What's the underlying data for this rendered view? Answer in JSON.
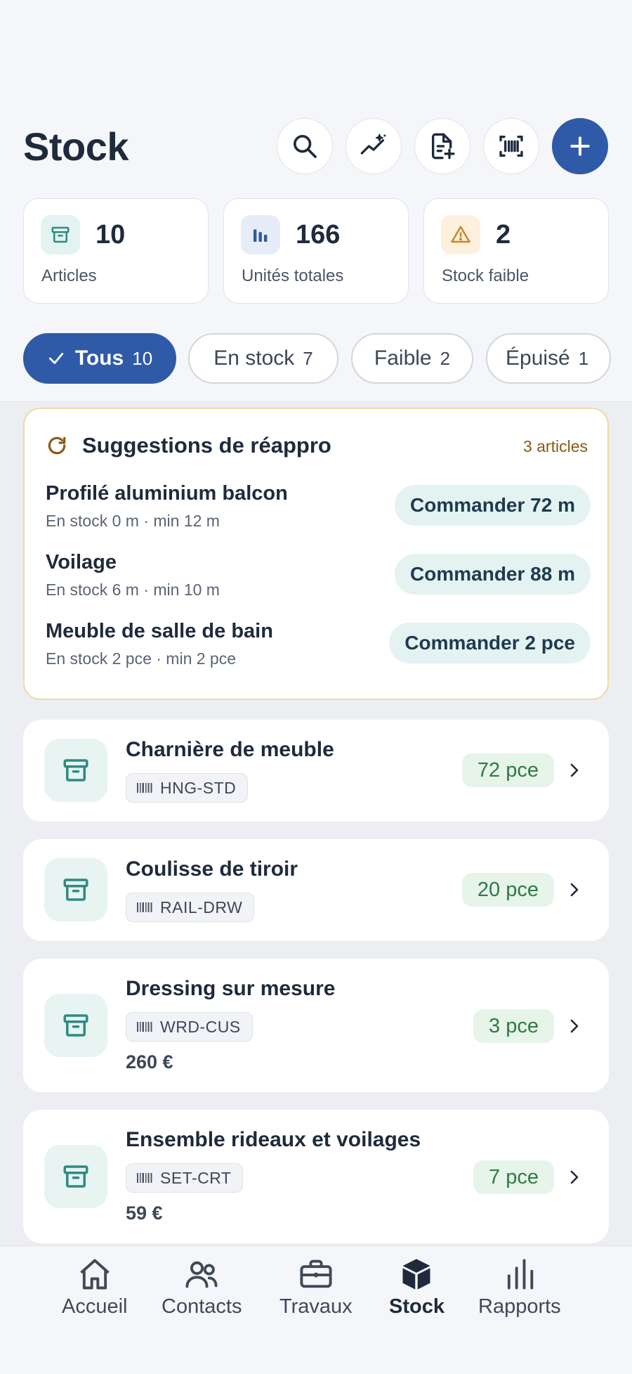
{
  "header": {
    "title": "Stock"
  },
  "actions": [
    {
      "name": "search-button",
      "icon": "search-icon"
    },
    {
      "name": "trend-button",
      "icon": "sparkle-trend-icon"
    },
    {
      "name": "add-document-button",
      "icon": "document-plus-icon"
    },
    {
      "name": "barcode-scan-button",
      "icon": "barcode-scan-icon"
    },
    {
      "name": "add-item-button",
      "icon": "plus-icon"
    }
  ],
  "stats": [
    {
      "value": "10",
      "label": "Articles",
      "icon": "archive-icon",
      "color": "#e3f3f1"
    },
    {
      "value": "166",
      "label": "Unités totales",
      "icon": "bars-icon",
      "color": "#e6ecf8"
    },
    {
      "value": "2",
      "label": "Stock faible",
      "icon": "warning-icon",
      "color": "#fdf0dd"
    }
  ],
  "filters": [
    {
      "label": "Tous",
      "count": "10",
      "active": true
    },
    {
      "label": "En stock",
      "count": "7"
    },
    {
      "label": "Faible",
      "count": "2"
    },
    {
      "label": "Épuisé",
      "count": "1"
    }
  ],
  "reappro": {
    "title": "Suggestions de réappro",
    "count": "3 articles",
    "items": [
      {
        "name": "Profilé aluminium balcon",
        "meta": "En stock 0 m · min 12 m",
        "action": "Commander 72 m"
      },
      {
        "name": "Voilage",
        "meta": "En stock 6 m · min 10 m",
        "action": "Commander 88 m"
      },
      {
        "name": "Meuble de salle de bain",
        "meta": "En stock 2 pce · min 2 pce",
        "action": "Commander 2 pce"
      }
    ]
  },
  "items": [
    {
      "name": "Charnière de meuble",
      "sku": "HNG-STD",
      "qty": "72 pce"
    },
    {
      "name": "Coulisse de tiroir",
      "sku": "RAIL-DRW",
      "qty": "20 pce"
    },
    {
      "name": "Dressing sur mesure",
      "sku": "WRD-CUS",
      "qty": "3 pce",
      "price": "260 €"
    },
    {
      "name": "Ensemble rideaux et voilages",
      "sku": "SET-CRT",
      "qty": "7 pce",
      "price": "59 €"
    }
  ],
  "nav": [
    {
      "label": "Accueil",
      "icon": "home-icon"
    },
    {
      "label": "Contacts",
      "icon": "users-icon"
    },
    {
      "label": "Travaux",
      "icon": "briefcase-icon"
    },
    {
      "label": "Stock",
      "icon": "box-icon",
      "active": true
    },
    {
      "label": "Rapports",
      "icon": "chart-icon"
    }
  ],
  "colors": {
    "primary": "#2f5aa8",
    "teal": "#2f8a82",
    "warning": "#c78a2a",
    "success": "#2f7a45"
  }
}
